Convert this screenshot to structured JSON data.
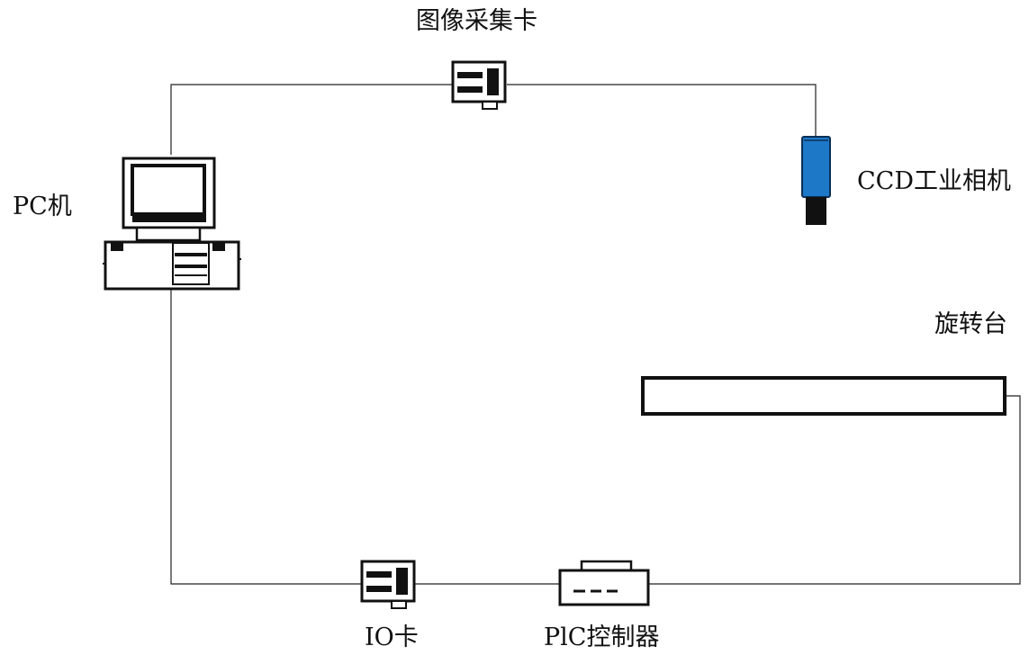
{
  "labels": {
    "capture_card": "图像采集卡",
    "pc": "PC机",
    "camera": "CCD工业相机",
    "rotary_stage": "旋转台",
    "io_card": "IO卡",
    "plc": "PlC控制器"
  },
  "colors": {
    "line": "#222222",
    "camera_body": "#1E78C8",
    "camera_lens": "#111111"
  },
  "icons": {
    "pc": "desktop-computer-icon",
    "capture_card": "expansion-card-icon",
    "io_card": "expansion-card-icon",
    "plc": "plc-controller-icon",
    "camera": "industrial-camera-icon",
    "rotary_stage": "rotary-stage-bar"
  }
}
